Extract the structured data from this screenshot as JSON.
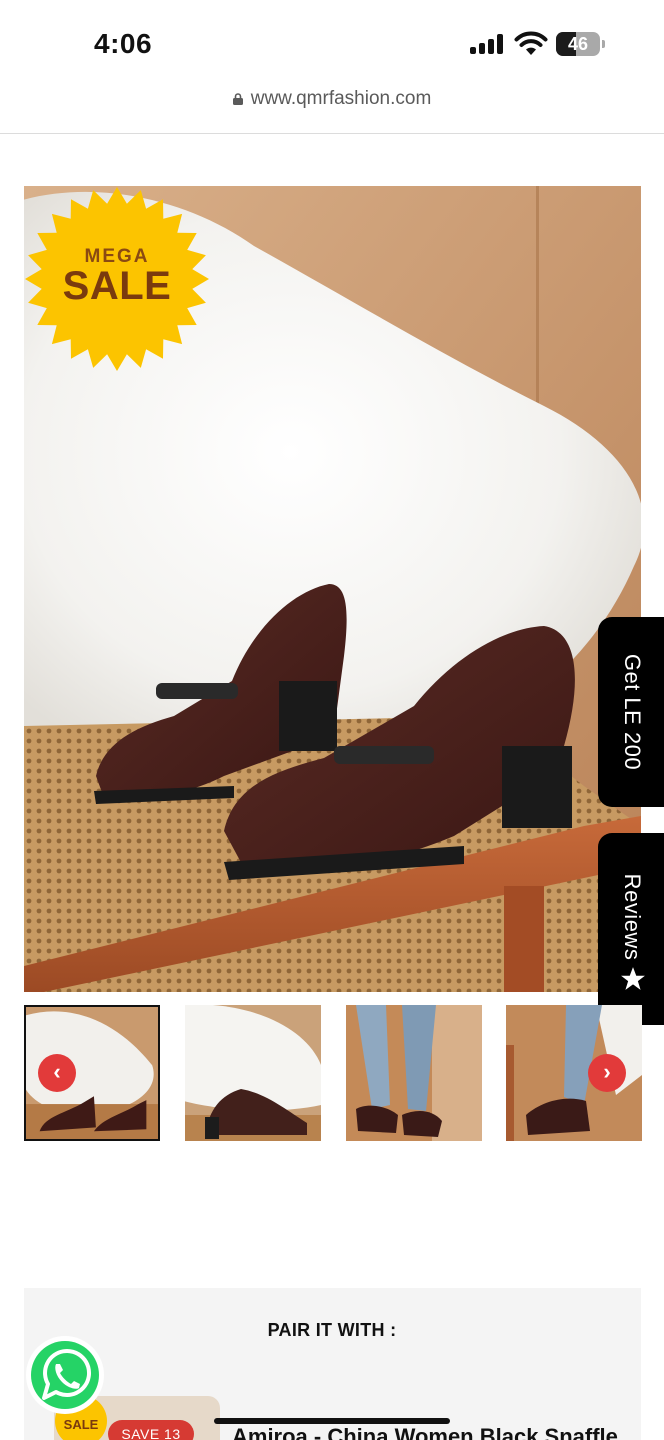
{
  "status_bar": {
    "time": "4:06",
    "battery_level": "46",
    "battery_fraction": 0.46,
    "icons": [
      "signal-icon",
      "wifi-icon",
      "battery-icon"
    ]
  },
  "browser": {
    "url": "www.qmrfashion.com",
    "lock_icon": "lock-icon"
  },
  "hero": {
    "badge_top": "MEGA",
    "badge_bottom": "SALE"
  },
  "side_tabs": {
    "coupon_label": "Get LE 200",
    "reviews_label": "Reviews",
    "reviews_icon": "star-icon"
  },
  "gallery": {
    "thumbnail_count": 4,
    "active_index": 0,
    "prev_glyph": "‹",
    "next_glyph": "›"
  },
  "pair_section": {
    "title": "PAIR IT WITH :",
    "badge_text": "SALE",
    "save_label": "SAVE 13",
    "product_name": "Amiroa - China Women Black Snaffle"
  },
  "colors": {
    "accent_red": "#e23a3a",
    "badge_yellow": "#fcc400",
    "tab_black": "#000000",
    "whatsapp_green": "#25d366"
  }
}
